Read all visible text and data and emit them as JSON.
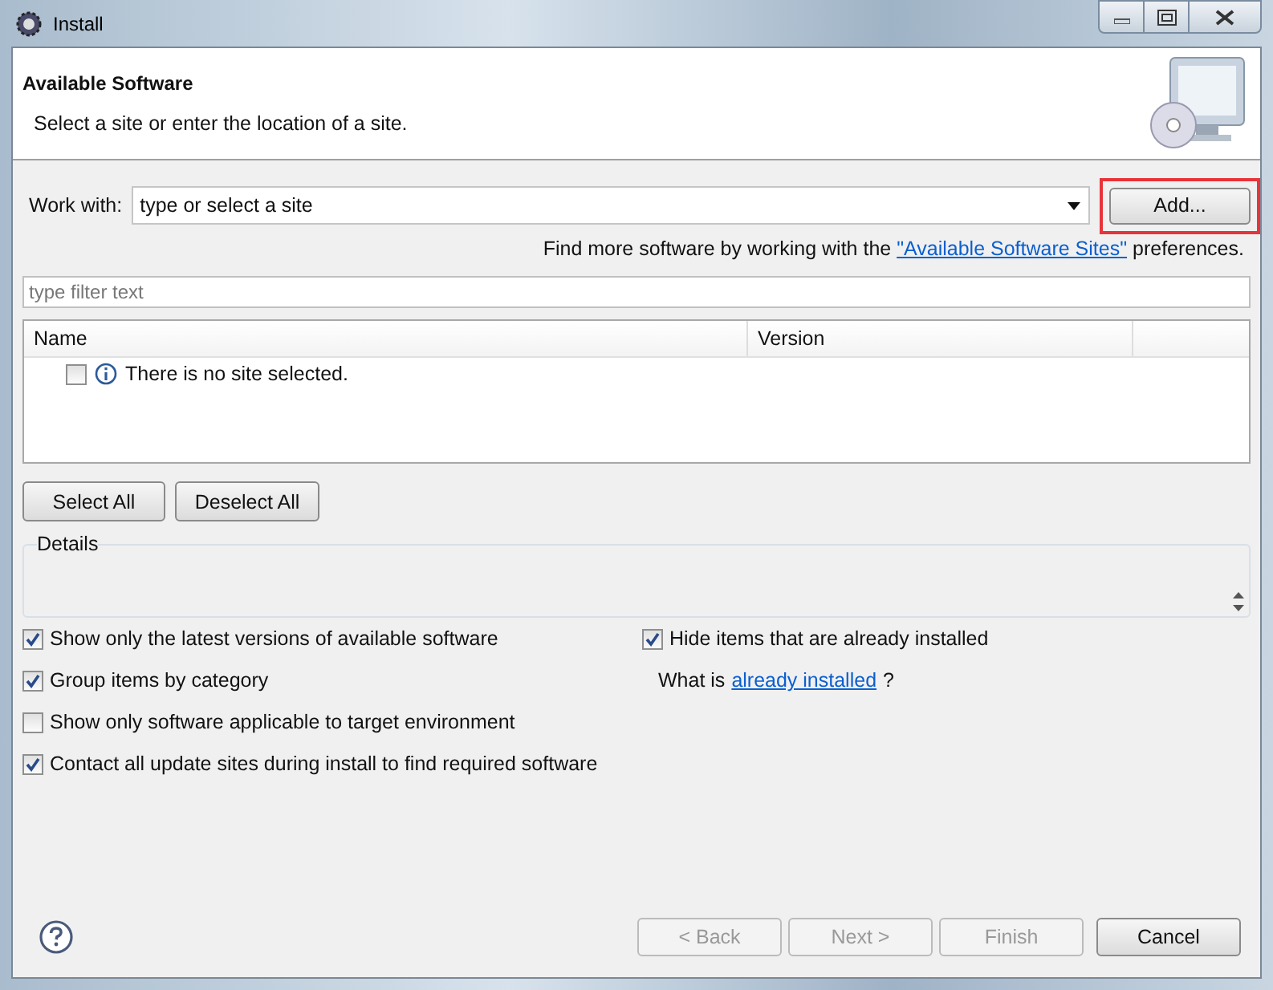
{
  "window": {
    "title": "Install"
  },
  "header": {
    "title": "Available Software",
    "subtitle": "Select a site or enter the location of a site."
  },
  "work_with": {
    "label": "Work with:",
    "value": "type or select a site",
    "add_button": {
      "label": "Add...",
      "highlighted": true
    }
  },
  "hint": {
    "text": "Find more software by working with the ",
    "link": "\"Available Software Sites\"",
    "suffix": " preferences."
  },
  "filter": {
    "placeholder": "type filter text"
  },
  "table": {
    "columns": [
      "Name",
      "Version"
    ],
    "rows": [
      {
        "text": "There is no site selected.",
        "checked": false
      }
    ]
  },
  "select_buttons": [
    "Select All",
    "Deselect All"
  ],
  "details": {
    "label": "Details"
  },
  "options": [
    {
      "label": "Show only the latest versions of available software",
      "checked": true
    },
    {
      "label": "Group items by category",
      "checked": true
    },
    {
      "label": "Show only software applicable to target environment",
      "checked": false
    },
    {
      "label": "Contact all update sites during install to find required software",
      "checked": true
    }
  ],
  "hide_installed": {
    "label": "Hide items that are already installed",
    "checked": true
  },
  "what_is": {
    "text": "What is ",
    "link": "already installed",
    "suffix": "?"
  },
  "buttons": [
    {
      "label": "< Back",
      "disabled": true
    },
    {
      "label": "Next >",
      "disabled": true
    },
    {
      "label": "Finish",
      "disabled": true
    },
    {
      "label": "Cancel",
      "disabled": false
    }
  ]
}
